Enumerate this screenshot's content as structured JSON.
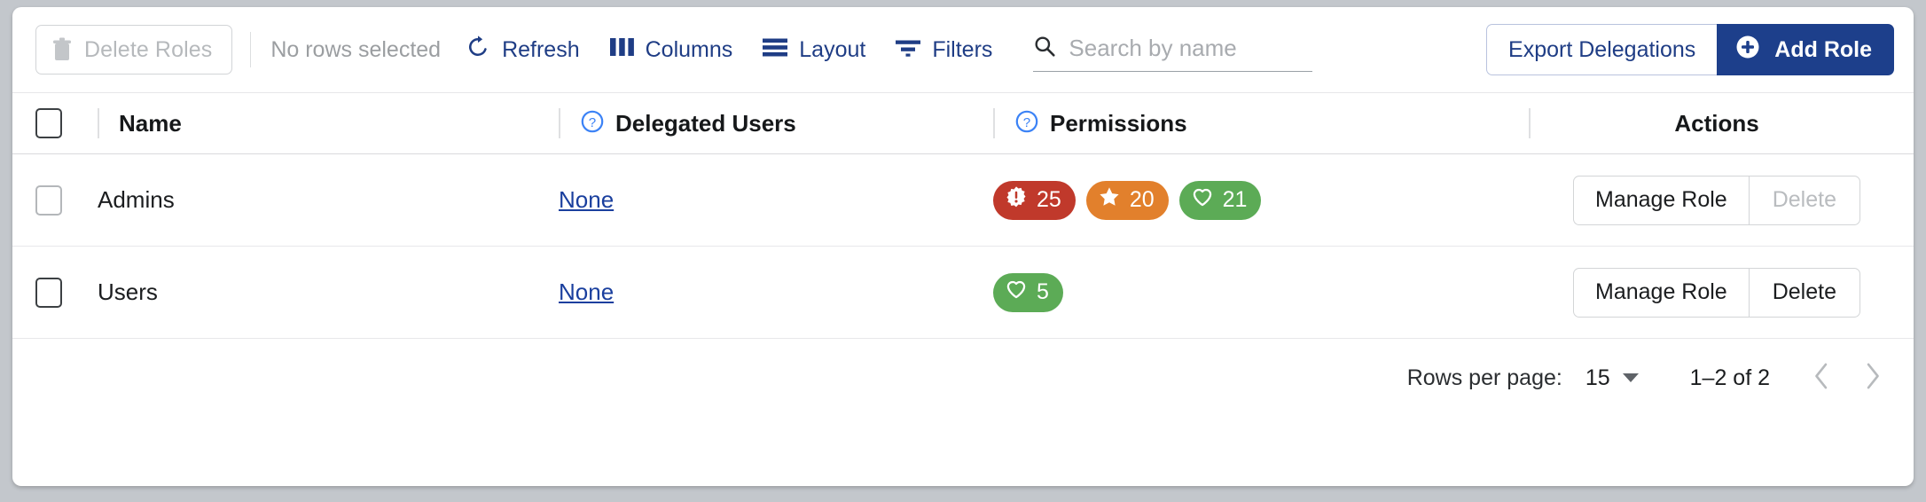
{
  "toolbar": {
    "delete_roles_label": "Delete Roles",
    "delete_roles_icon": "trash-icon",
    "selection_status": "No rows selected",
    "items": [
      {
        "label": "Refresh",
        "icon": "refresh-icon"
      },
      {
        "label": "Columns",
        "icon": "columns-icon"
      },
      {
        "label": "Layout",
        "icon": "layout-icon"
      },
      {
        "label": "Filters",
        "icon": "filter-icon"
      }
    ],
    "search": {
      "icon": "search-icon",
      "placeholder": "Search by name",
      "value": ""
    },
    "export_label": "Export Delegations",
    "add_role_label": "Add Role",
    "add_role_icon": "plus-circle-icon"
  },
  "table": {
    "headers": {
      "select_all": "select-all-checkbox",
      "name": "Name",
      "delegated_users": "Delegated Users",
      "permissions": "Permissions",
      "actions": "Actions",
      "help_icon": "help-circle-icon"
    },
    "rows": [
      {
        "selected": false,
        "name": "Admins",
        "delegated_users": "None",
        "permissions": [
          {
            "icon": "burst-alert-icon",
            "count": "25",
            "color": "#c0392b"
          },
          {
            "icon": "star-icon",
            "count": "20",
            "color": "#e2802c"
          },
          {
            "icon": "heart-icon",
            "count": "21",
            "color": "#5cab56"
          }
        ],
        "manage_label": "Manage Role",
        "delete_label": "Delete",
        "delete_disabled": true
      },
      {
        "selected": false,
        "name": "Users",
        "delegated_users": "None",
        "permissions": [
          {
            "icon": "heart-icon",
            "count": "5",
            "color": "#5cab56"
          }
        ],
        "manage_label": "Manage Role",
        "delete_label": "Delete",
        "delete_disabled": false
      }
    ]
  },
  "footer": {
    "rows_per_page_label": "Rows per page:",
    "rows_per_page_value": "15",
    "range_label": "1–2 of 2",
    "prev_icon": "chevron-left-icon",
    "next_icon": "chevron-right-icon"
  },
  "colors": {
    "brand": "#1d3f8b",
    "link": "#1a3f9e",
    "red_badge": "#c0392b",
    "orange_badge": "#e2802c",
    "green_badge": "#5cab56"
  }
}
